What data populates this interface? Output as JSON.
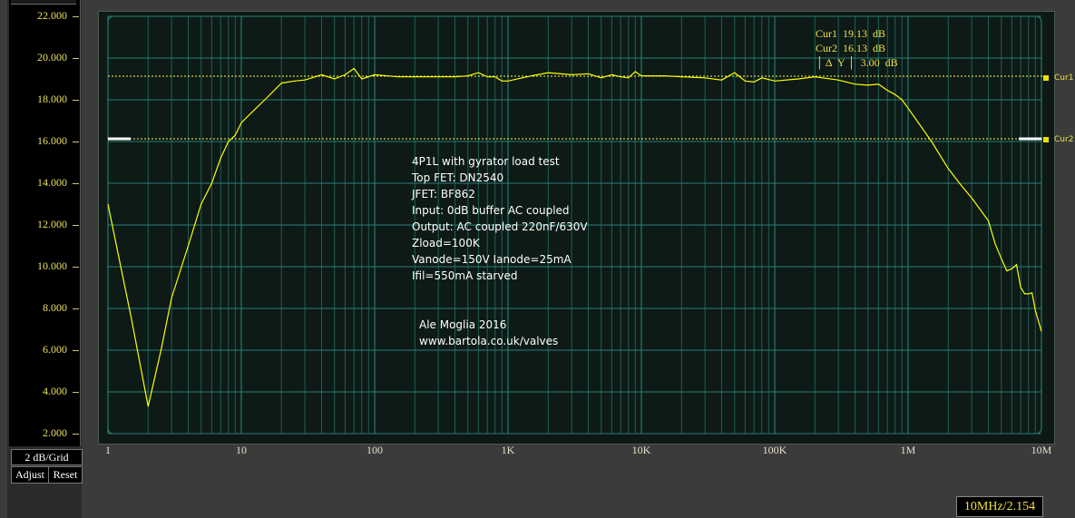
{
  "chart_data": {
    "type": "line",
    "xscale": "log",
    "xlim": [
      1,
      10000000
    ],
    "ylim": [
      2,
      22
    ],
    "y_ticks": [
      "22.000",
      "20.000",
      "18.000",
      "16.000",
      "14.000",
      "12.000",
      "10.000",
      "8.000",
      "6.000",
      "4.000",
      "2.000"
    ],
    "x_ticks": [
      {
        "value": 1,
        "label": "1"
      },
      {
        "value": 10,
        "label": "10"
      },
      {
        "value": 100,
        "label": "100"
      },
      {
        "value": 1000,
        "label": "1K"
      },
      {
        "value": 10000,
        "label": "10K"
      },
      {
        "value": 100000,
        "label": "100K"
      },
      {
        "value": 1000000,
        "label": "1M"
      },
      {
        "value": 10000000,
        "label": "10M"
      }
    ],
    "grid": true,
    "series": [
      {
        "color": "#ffff00",
        "points": [
          [
            1,
            13.0
          ],
          [
            1.5,
            7.5
          ],
          [
            2.0,
            3.3
          ],
          [
            2.5,
            6.0
          ],
          [
            3.0,
            8.5
          ],
          [
            4.0,
            11.0
          ],
          [
            5.0,
            13.0
          ],
          [
            6.0,
            14.0
          ],
          [
            7.0,
            15.2
          ],
          [
            8.0,
            16.0
          ],
          [
            9.0,
            16.3
          ],
          [
            10,
            16.9
          ],
          [
            12,
            17.4
          ],
          [
            15,
            18.0
          ],
          [
            20,
            18.8
          ],
          [
            25,
            18.9
          ],
          [
            30,
            18.95
          ],
          [
            40,
            19.2
          ],
          [
            50,
            19.0
          ],
          [
            60,
            19.2
          ],
          [
            70,
            19.5
          ],
          [
            80,
            19.0
          ],
          [
            100,
            19.2
          ],
          [
            150,
            19.1
          ],
          [
            200,
            19.1
          ],
          [
            300,
            19.1
          ],
          [
            400,
            19.1
          ],
          [
            500,
            19.15
          ],
          [
            600,
            19.3
          ],
          [
            700,
            19.1
          ],
          [
            800,
            19.1
          ],
          [
            900,
            18.9
          ],
          [
            1000,
            18.9
          ],
          [
            1500,
            19.15
          ],
          [
            2000,
            19.3
          ],
          [
            3000,
            19.2
          ],
          [
            4000,
            19.25
          ],
          [
            5000,
            19.05
          ],
          [
            6000,
            19.2
          ],
          [
            7000,
            19.1
          ],
          [
            8000,
            19.05
          ],
          [
            9000,
            19.35
          ],
          [
            10000,
            19.15
          ],
          [
            15000,
            19.15
          ],
          [
            20000,
            19.1
          ],
          [
            30000,
            19.05
          ],
          [
            40000,
            18.95
          ],
          [
            50000,
            19.3
          ],
          [
            60000,
            18.9
          ],
          [
            70000,
            18.85
          ],
          [
            80000,
            19.05
          ],
          [
            100000,
            18.9
          ],
          [
            150000,
            19.0
          ],
          [
            200000,
            19.1
          ],
          [
            300000,
            18.95
          ],
          [
            400000,
            18.75
          ],
          [
            500000,
            18.7
          ],
          [
            600000,
            18.75
          ],
          [
            700000,
            18.45
          ],
          [
            800000,
            18.25
          ],
          [
            900000,
            18.0
          ],
          [
            1000000,
            17.6
          ],
          [
            1500000,
            16.0
          ],
          [
            2000000,
            14.7
          ],
          [
            2500000,
            13.9
          ],
          [
            3000000,
            13.3
          ],
          [
            4000000,
            12.2
          ],
          [
            4500000,
            11.1
          ],
          [
            5000000,
            10.4
          ],
          [
            5500000,
            9.8
          ],
          [
            6000000,
            9.9
          ],
          [
            6500000,
            10.1
          ],
          [
            7000000,
            9.0
          ],
          [
            7500000,
            8.7
          ],
          [
            8000000,
            8.7
          ],
          [
            8500000,
            8.75
          ],
          [
            9000000,
            7.9
          ],
          [
            10000000,
            6.9
          ]
        ]
      }
    ],
    "cursors": [
      {
        "name": "Cur1",
        "value": 19.13,
        "color": "#ffff40"
      },
      {
        "name": "Cur2",
        "value": 16.13,
        "color": "#ffff40"
      }
    ]
  },
  "readout": {
    "cur1": "Cur1  19.13  dB",
    "cur2": "Cur2  16.13  dB",
    "delta": "│ Δ  Y │  3.00  dB"
  },
  "annotation": {
    "lines": [
      "4P1L with gyrator load test",
      "Top FET: DN2540",
      "JFET: BF862",
      "Input: 0dB buffer AC coupled",
      "Output: AC coupled 220nF/630V",
      "Zload=100K",
      "Vanode=150V Ianode=25mA",
      "Ifil=550mA starved"
    ],
    "credit": [
      "Ale Moglia 2016",
      "www.bartola.co.uk/valves"
    ]
  },
  "left_panel": {
    "grid_label": "2 dB/Grid",
    "adjust_label": "Adjust",
    "reset_label": "Reset"
  },
  "cursor_tags": {
    "cur1": "Cur1",
    "cur2": "Cur2"
  },
  "status": "10MHz/2.154"
}
